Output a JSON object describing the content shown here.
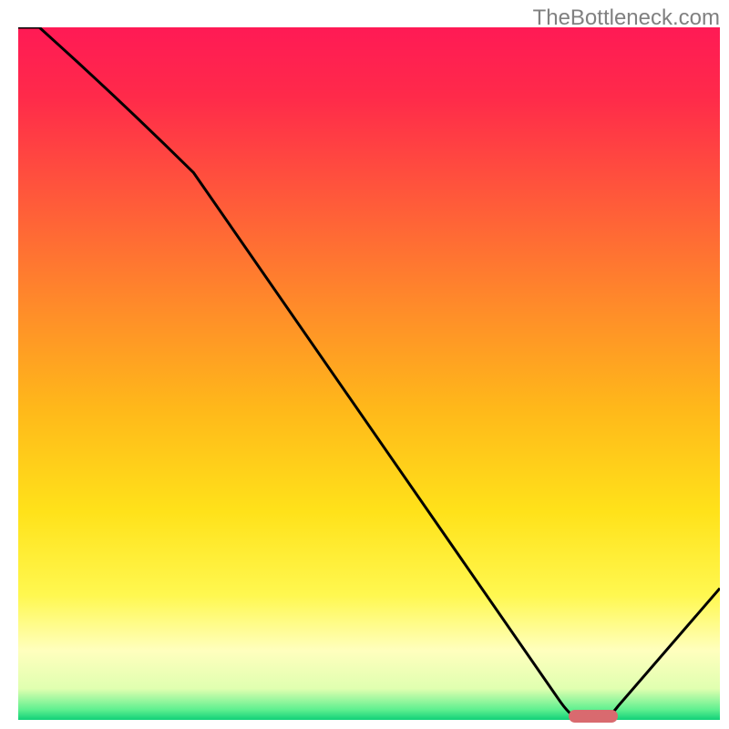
{
  "watermark": "TheBottleneck.com",
  "chart_data": {
    "type": "line",
    "title": "",
    "xlabel": "",
    "ylabel": "",
    "x": [
      0.0,
      0.03,
      0.25,
      0.79,
      0.81,
      0.84,
      1.0
    ],
    "values": [
      1.0,
      1.0,
      0.79,
      0.0,
      0.0,
      0.0,
      0.19
    ],
    "xlim": [
      0,
      1
    ],
    "ylim": [
      0,
      1
    ],
    "gradient_stops": [
      {
        "offset": 0.0,
        "color": "#ff1a55"
      },
      {
        "offset": 0.1,
        "color": "#ff2a4a"
      },
      {
        "offset": 0.25,
        "color": "#ff5a3a"
      },
      {
        "offset": 0.4,
        "color": "#ff8a2a"
      },
      {
        "offset": 0.55,
        "color": "#ffb81a"
      },
      {
        "offset": 0.7,
        "color": "#ffe21a"
      },
      {
        "offset": 0.82,
        "color": "#fff850"
      },
      {
        "offset": 0.9,
        "color": "#ffffbe"
      },
      {
        "offset": 0.955,
        "color": "#e0ffb0"
      },
      {
        "offset": 0.985,
        "color": "#60f090"
      },
      {
        "offset": 1.0,
        "color": "#10d078"
      }
    ],
    "marker": {
      "x_start": 0.785,
      "x_end": 0.855,
      "y": 0.0,
      "color": "#d96a6f"
    }
  }
}
